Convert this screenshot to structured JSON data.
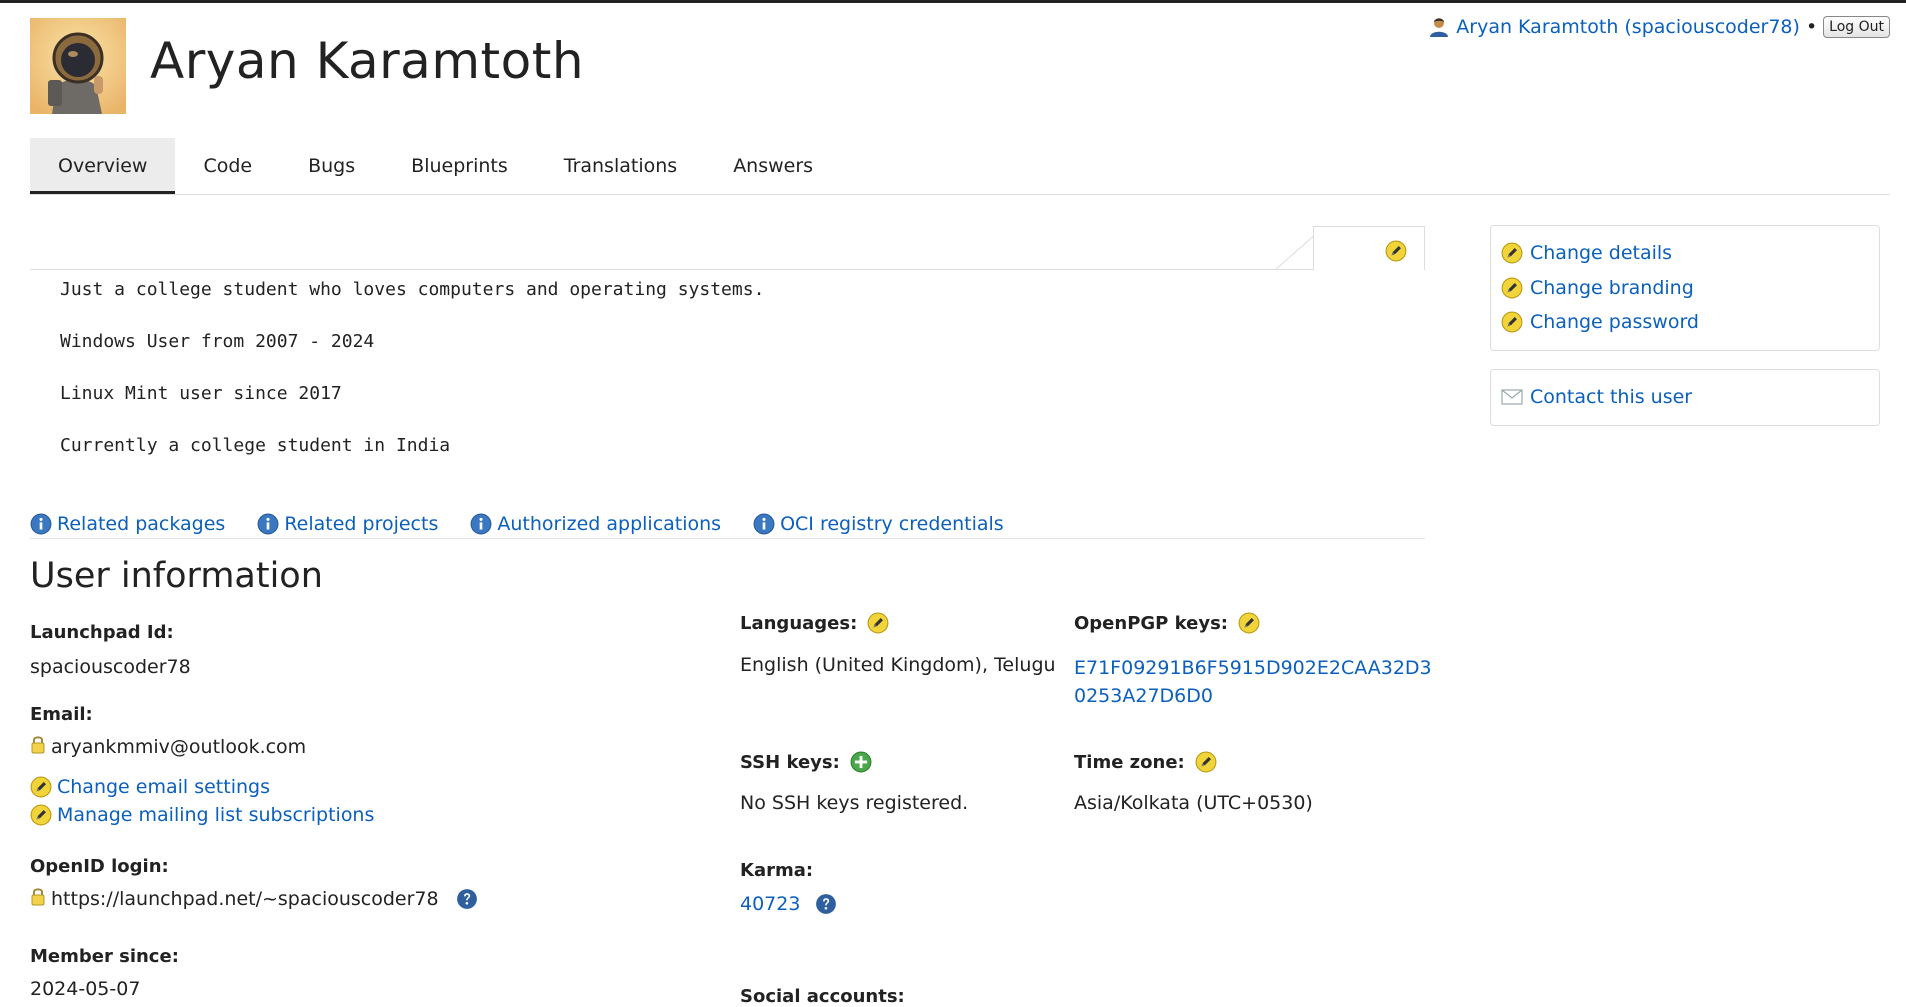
{
  "header": {
    "title": "Aryan Karamtoth",
    "login_user": "Aryan Karamtoth (spaciouscoder78)",
    "separator": "•",
    "logout_label": "Log Out"
  },
  "tabs": [
    {
      "label": "Overview",
      "active": true
    },
    {
      "label": "Code"
    },
    {
      "label": "Bugs"
    },
    {
      "label": "Blueprints"
    },
    {
      "label": "Translations"
    },
    {
      "label": "Answers"
    }
  ],
  "bio": {
    "lines": [
      "Just a college student who loves computers and operating systems.",
      "Windows User from 2007 - 2024",
      "Linux Mint user since 2017",
      "Currently a college student in India"
    ]
  },
  "sidebar": {
    "actions": [
      {
        "label": "Change details"
      },
      {
        "label": "Change branding"
      },
      {
        "label": "Change password"
      }
    ],
    "contact_label": "Contact this user"
  },
  "related": [
    {
      "label": "Related packages"
    },
    {
      "label": "Related projects"
    },
    {
      "label": "Authorized applications"
    },
    {
      "label": "OCI registry credentials"
    }
  ],
  "user_info": {
    "title": "User information",
    "launchpad_id_label": "Launchpad Id:",
    "launchpad_id": "spaciouscoder78",
    "email_label": "Email:",
    "email": "aryankmmiv@outlook.com",
    "change_email_label": "Change email settings",
    "mailing_lists_label": "Manage mailing list subscriptions",
    "openid_label": "OpenID login:",
    "openid": "https://launchpad.net/~spaciouscoder78",
    "member_since_label": "Member since:",
    "member_since": "2024-05-07",
    "languages_label": "Languages:",
    "languages": "English (United Kingdom), Telugu",
    "ssh_label": "SSH keys:",
    "ssh_value": "No SSH keys registered.",
    "karma_label": "Karma:",
    "karma": "40723",
    "social_label": "Social accounts:",
    "openpgp_label": "OpenPGP keys:",
    "openpgp_line1": "E71F09291B6F5915D902E2CAA32D3",
    "openpgp_line2": "0253A27D6D0",
    "timezone_label": "Time zone:",
    "timezone": "Asia/Kolkata (UTC+0530)"
  },
  "colors": {
    "link": "#0b60bd",
    "edit_icon": "#e8c62a",
    "info_icon": "#3b78c2",
    "add_icon": "#3a9b3a"
  }
}
